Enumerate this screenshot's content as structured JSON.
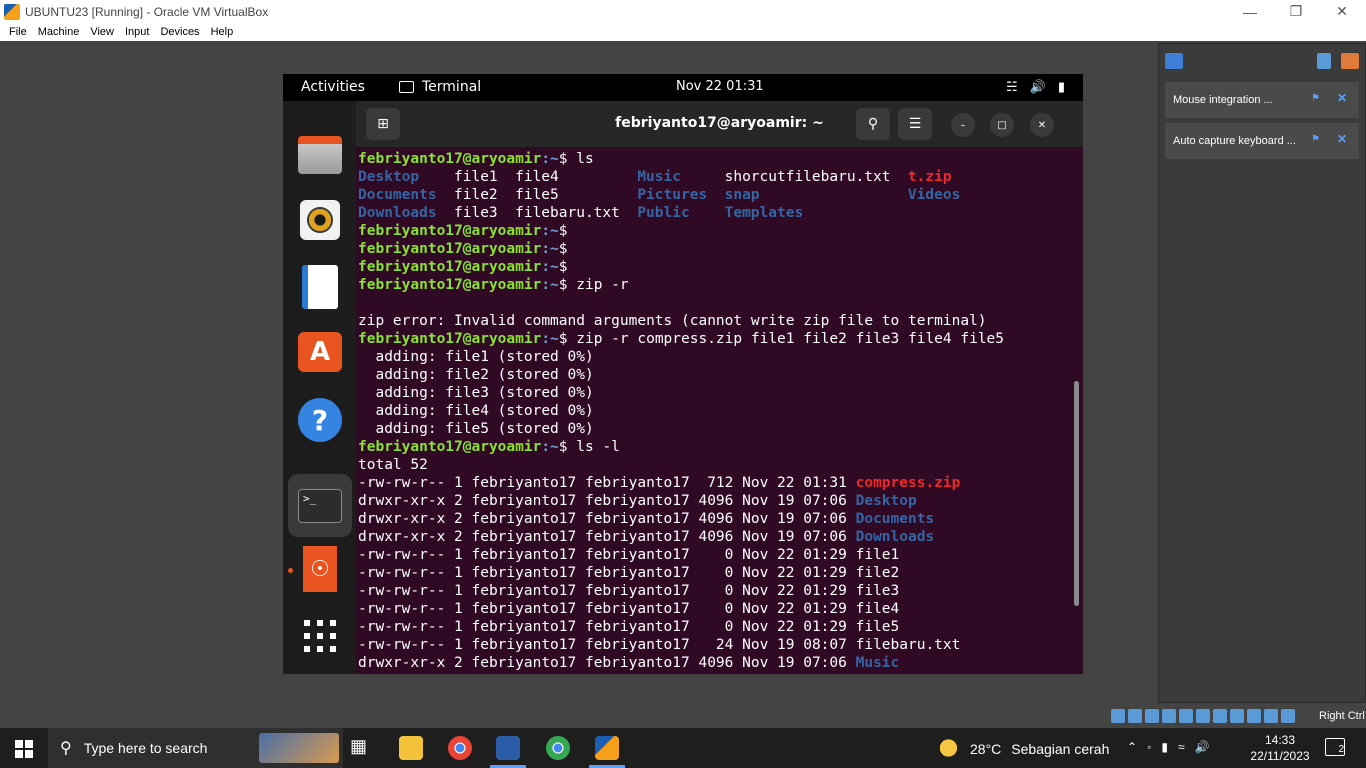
{
  "host_window": {
    "title": "UBUNTU23 [Running] - Oracle VM VirtualBox",
    "menu": [
      "File",
      "Machine",
      "View",
      "Input",
      "Devices",
      "Help"
    ],
    "status_right": "Right Ctrl"
  },
  "side_panel": {
    "notifications": [
      {
        "label": "Mouse integration ..."
      },
      {
        "label": "Auto capture keyboard ..."
      }
    ]
  },
  "gnome": {
    "activities": "Activities",
    "app_name": "Terminal",
    "clock": "Nov 22  01:31"
  },
  "dock_items": [
    "files-icon",
    "rhythmbox-icon",
    "writer-icon",
    "app-center-icon",
    "help-icon",
    "terminal-icon",
    "ubuntu-installer-icon",
    "app-grid-icon"
  ],
  "terminal": {
    "title": "febriyanto17@aryoamir: ~",
    "prompt_user": "febriyanto17@aryoamir",
    "prompt_path": ":~",
    "prompt_dollar": "$",
    "ls_rows": [
      [
        {
          "t": "Desktop",
          "c": "dir",
          "w": 11
        },
        {
          "t": "file1",
          "c": "",
          "w": 7
        },
        {
          "t": "file4",
          "c": "",
          "w": 14
        },
        {
          "t": "Music",
          "c": "dir",
          "w": 10
        },
        {
          "t": "shorcutfilebaru.txt",
          "c": "",
          "w": 21
        },
        {
          "t": "t.zip",
          "c": "zip",
          "w": 0
        }
      ],
      [
        {
          "t": "Documents",
          "c": "dir",
          "w": 11
        },
        {
          "t": "file2",
          "c": "",
          "w": 7
        },
        {
          "t": "file5",
          "c": "",
          "w": 14
        },
        {
          "t": "Pictures",
          "c": "dir",
          "w": 10
        },
        {
          "t": "snap",
          "c": "dir",
          "w": 21
        },
        {
          "t": "Videos",
          "c": "dir",
          "w": 0
        }
      ],
      [
        {
          "t": "Downloads",
          "c": "dir",
          "w": 11
        },
        {
          "t": "file3",
          "c": "",
          "w": 7
        },
        {
          "t": "filebaru.txt",
          "c": "",
          "w": 14
        },
        {
          "t": "Public",
          "c": "dir",
          "w": 10
        },
        {
          "t": "Templates",
          "c": "dir",
          "w": 21
        },
        {
          "t": "",
          "c": "",
          "w": 0
        }
      ]
    ],
    "cmd_ls": " ls",
    "cmd_zip_r": " zip -r",
    "zip_error": "zip error: Invalid command arguments (cannot write zip file to terminal)",
    "cmd_zip_full": " zip -r compress.zip file1 file2 file3 file4 file5",
    "adding": [
      "  adding: file1 (stored 0%)",
      "  adding: file2 (stored 0%)",
      "  adding: file3 (stored 0%)",
      "  adding: file4 (stored 0%)",
      "  adding: file5 (stored 0%)"
    ],
    "cmd_ls_l": " ls -l",
    "total": "total 52",
    "ls_l_rows": [
      {
        "meta": "-rw-rw-r-- 1 febriyanto17 febriyanto17  712 Nov 22 01:31 ",
        "name": "compress.zip",
        "c": "zip"
      },
      {
        "meta": "drwxr-xr-x 2 febriyanto17 febriyanto17 4096 Nov 19 07:06 ",
        "name": "Desktop",
        "c": "dir"
      },
      {
        "meta": "drwxr-xr-x 2 febriyanto17 febriyanto17 4096 Nov 19 07:06 ",
        "name": "Documents",
        "c": "dir"
      },
      {
        "meta": "drwxr-xr-x 2 febriyanto17 febriyanto17 4096 Nov 19 07:06 ",
        "name": "Downloads",
        "c": "dir"
      },
      {
        "meta": "-rw-rw-r-- 1 febriyanto17 febriyanto17    0 Nov 22 01:29 ",
        "name": "file1",
        "c": ""
      },
      {
        "meta": "-rw-rw-r-- 1 febriyanto17 febriyanto17    0 Nov 22 01:29 ",
        "name": "file2",
        "c": ""
      },
      {
        "meta": "-rw-rw-r-- 1 febriyanto17 febriyanto17    0 Nov 22 01:29 ",
        "name": "file3",
        "c": ""
      },
      {
        "meta": "-rw-rw-r-- 1 febriyanto17 febriyanto17    0 Nov 22 01:29 ",
        "name": "file4",
        "c": ""
      },
      {
        "meta": "-rw-rw-r-- 1 febriyanto17 febriyanto17    0 Nov 22 01:29 ",
        "name": "file5",
        "c": ""
      },
      {
        "meta": "-rw-rw-r-- 1 febriyanto17 febriyanto17   24 Nov 19 08:07 ",
        "name": "filebaru.txt",
        "c": ""
      },
      {
        "meta": "drwxr-xr-x 2 febriyanto17 febriyanto17 4096 Nov 19 07:06 ",
        "name": "Music",
        "c": "dir"
      }
    ]
  },
  "taskbar": {
    "search_placeholder": "Type here to search",
    "weather_temp": "28°C",
    "weather_desc": "Sebagian cerah",
    "time": "14:33",
    "date": "22/11/2023",
    "notification_count": "2"
  },
  "colors": {
    "terminal_bg": "#300a24",
    "prompt_user": "#8ae234",
    "prompt_path": "#729fcf",
    "directory": "#3465a4",
    "archive": "#ef2929",
    "ubuntu_orange": "#e95420"
  }
}
